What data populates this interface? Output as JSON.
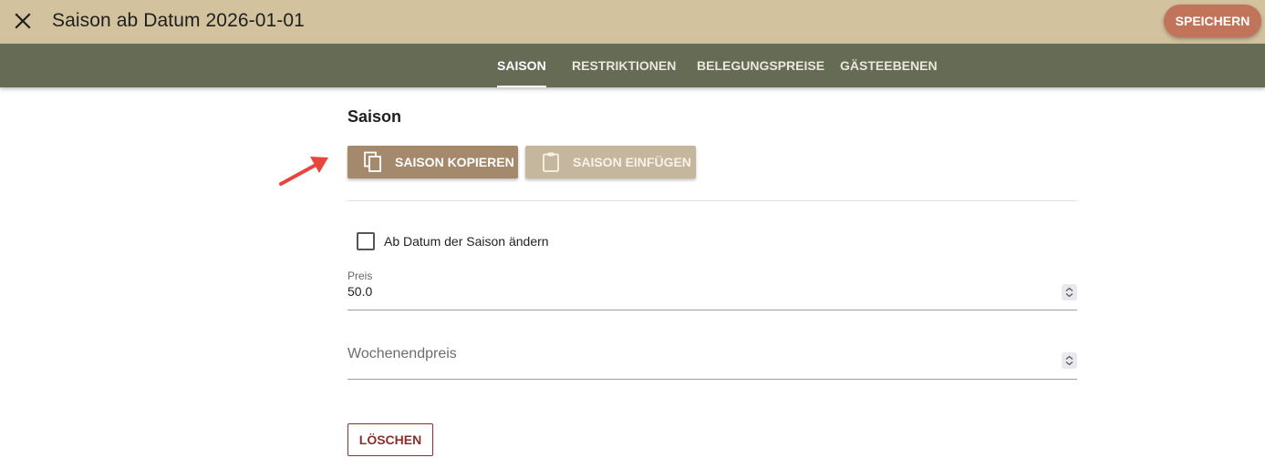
{
  "header": {
    "close_icon": "close-icon",
    "title": "Saison ab Datum 2026-01-01",
    "save_label": "SPEICHERN",
    "colors": {
      "bar": "#d2c29e",
      "save": "#c2745a"
    }
  },
  "tabs": {
    "items": [
      {
        "label": "SAISON",
        "active": true
      },
      {
        "label": "RESTRIKTIONEN",
        "active": false
      },
      {
        "label": "BELEGUNGSPREISE",
        "active": false
      },
      {
        "label": "GÄSTEEBENEN",
        "active": false
      }
    ],
    "color": "#656b55"
  },
  "main": {
    "section_title": "Saison",
    "copy_button": {
      "label": "SAISON KOPIEREN",
      "icon": "copy-icon"
    },
    "paste_button": {
      "label": "SAISON EINFÜGEN",
      "icon": "clipboard-icon"
    },
    "checkbox": {
      "label": "Ab Datum der Saison ändern",
      "checked": false
    },
    "price": {
      "label": "Preis",
      "value": "50.0"
    },
    "weekend_price": {
      "placeholder": "Wochenendpreis",
      "value": ""
    },
    "delete_label": "LÖSCHEN"
  },
  "annotation": {
    "arrow_color": "#e8453c"
  }
}
